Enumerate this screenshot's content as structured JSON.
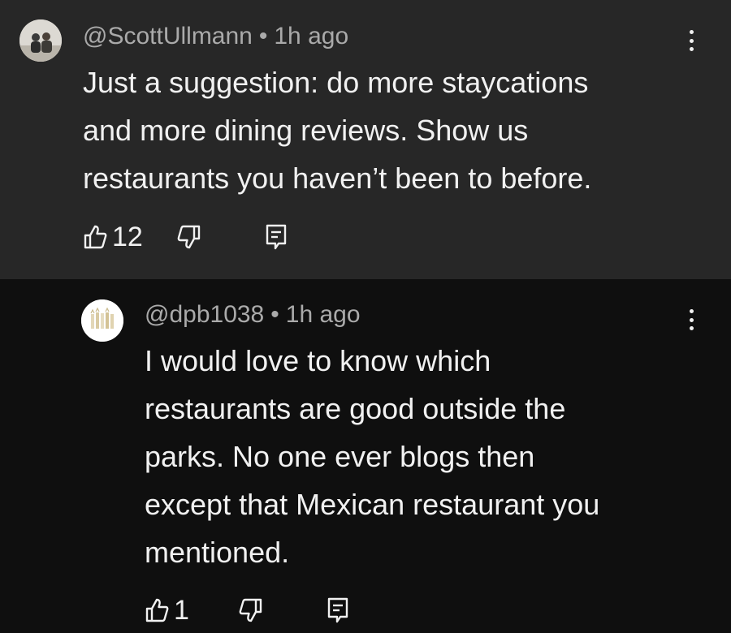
{
  "comments": [
    {
      "handle": "@ScottUllmann",
      "separator": "•",
      "time": "1h ago",
      "text": "Just a suggestion: do more staycations\nand more dining reviews. Show us\nrestaurants you haven’t been to before.",
      "likes": "12",
      "icons": [
        "thumbs-up-icon",
        "thumbs-down-icon",
        "reply-comment-icon",
        "more-vert-icon"
      ]
    },
    {
      "handle": "@dpb1038",
      "separator": "•",
      "time": "1h ago",
      "text": "I would love to know which\nrestaurants are good outside the\nparks. No one ever blogs then\nexcept that Mexican restaurant you\nmentioned.",
      "likes": "1",
      "icons": [
        "thumbs-up-icon",
        "thumbs-down-icon",
        "reply-comment-icon",
        "more-vert-icon"
      ]
    }
  ],
  "colors": {
    "parent_bg": "#272727",
    "reply_bg": "#0f0f0f",
    "text": "#f1f1f1",
    "meta": "#aaaaaa"
  }
}
